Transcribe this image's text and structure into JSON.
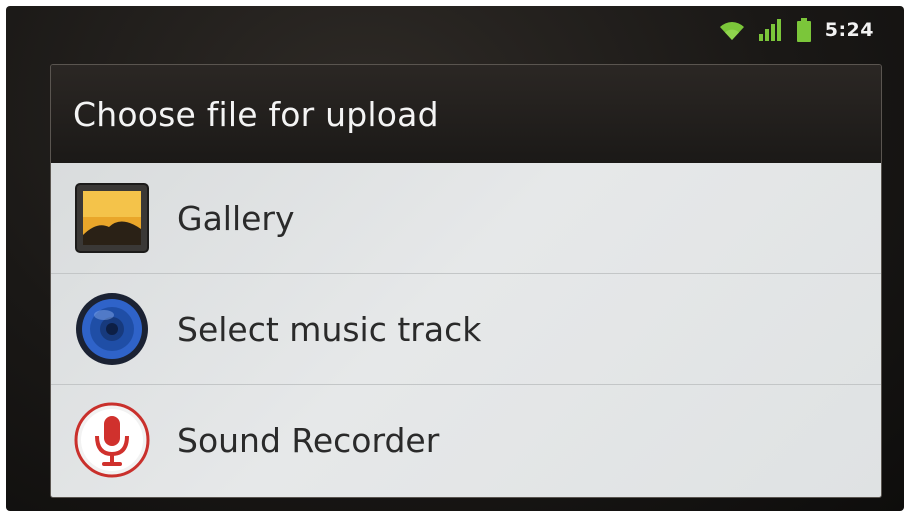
{
  "status_bar": {
    "time": "5:24",
    "icons": [
      "wifi-icon",
      "signal-bars-icon",
      "battery-icon"
    ],
    "accent_color": "#7bc63a"
  },
  "dialog": {
    "title": "Choose file for upload",
    "options": [
      {
        "label": "Gallery",
        "icon": "gallery-icon"
      },
      {
        "label": "Select music track",
        "icon": "music-speaker-icon"
      },
      {
        "label": "Sound Recorder",
        "icon": "microphone-icon"
      }
    ]
  }
}
